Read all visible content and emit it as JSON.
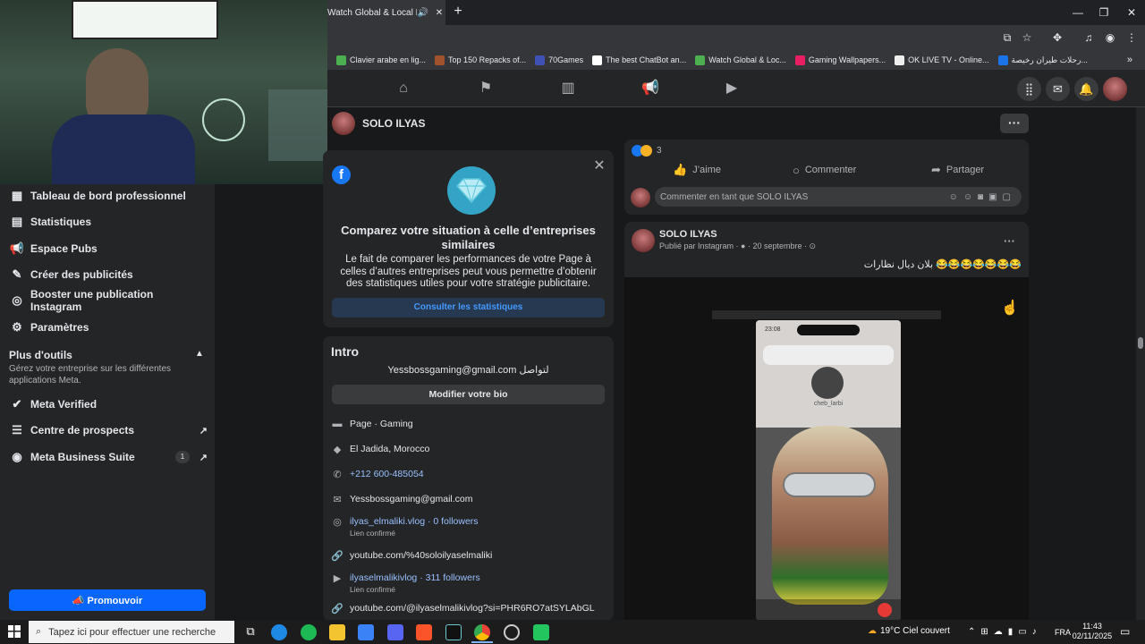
{
  "browser": {
    "tab_title": "Watch Global & Local Live",
    "tab_audio": "🔊",
    "tab_close": "✕",
    "new_tab": "+",
    "window": {
      "minimize": "—",
      "maximize": "❐",
      "close": "✕"
    },
    "bookmarks": [
      {
        "label": "Clavier arabe en lig...",
        "color": "#4caf50"
      },
      {
        "label": "Top 150 Repacks of...",
        "color": "#a0522d"
      },
      {
        "label": "70Games",
        "color": "#3f51b5"
      },
      {
        "label": "The best ChatBot an...",
        "color": "#ffffff"
      },
      {
        "label": "Watch Global & Loc...",
        "color": "#4caf50"
      },
      {
        "label": "Gaming Wallpapers...",
        "color": "#e91e63"
      },
      {
        "label": "OK LIVE TV - Online...",
        "color": "#eeeeee"
      },
      {
        "label": "رحلات طيران رخيصة...",
        "color": "#1a73e8"
      }
    ],
    "bookmarks_more": "»"
  },
  "fb_nav": {
    "icons": [
      "home-icon",
      "flag-icon",
      "chart-icon",
      "megaphone-icon",
      "video-icon"
    ],
    "right_icons": [
      "menu-grid-icon",
      "messenger-icon",
      "bell-icon"
    ]
  },
  "page": {
    "name": "SOLO ILYAS",
    "more": "···"
  },
  "left_menu": {
    "items": [
      {
        "label": "Tableau de bord professionnel",
        "icon": "dashboard-icon"
      },
      {
        "label": "Statistiques",
        "icon": "stats-icon"
      },
      {
        "label": "Espace Pubs",
        "icon": "ads-icon"
      },
      {
        "label": "Créer des publicités",
        "icon": "edit-icon"
      },
      {
        "label": "Booster une publication Instagram",
        "icon": "instagram-icon"
      },
      {
        "label": "Paramètres",
        "icon": "gear-icon"
      }
    ],
    "plus_title": "Plus d'outils",
    "plus_desc": "Gérez votre entreprise sur les différentes applications Meta.",
    "tools": [
      {
        "label": "Meta Verified",
        "icon": "verified-icon"
      },
      {
        "label": "Centre de prospects",
        "icon": "prospects-icon"
      },
      {
        "label": "Meta Business Suite",
        "icon": "business-suite-icon"
      }
    ],
    "badge": "1",
    "promote": "📣 Promouvoir"
  },
  "compare_card": {
    "title": "Comparez votre situation à celle d’entreprises similaires",
    "text": "Le fait de comparer les performances de votre Page à celles d’autres entreprises peut vous permettre d’obtenir des statistiques utiles pour votre stratégie publicitaire.",
    "button": "Consulter les statistiques"
  },
  "intro": {
    "title": "Intro",
    "bio": "Yessbossgaming@gmail.com لتواصل",
    "edit_bio": "Modifier votre bio",
    "category": "Page · Gaming",
    "location": "El Jadida, Morocco",
    "phone": "+212 600-485054",
    "email": "Yessbossgaming@gmail.com",
    "instagram": "ilyas_elmaliki.vlog · 0 followers",
    "instagram_sub": "Lien confirmé",
    "youtube1": "youtube.com/%40soloilyaselmaliki",
    "youtube_channel": "ilyaselmalikivlog · 311 followers",
    "youtube_channel_sub": "Lien confirmé",
    "youtube2": "youtube.com/@ilyaselmalikivlog?si=PHR6RO7atSYLAbGL"
  },
  "post1": {
    "reaction_count": "3",
    "like": "J’aime",
    "comment": "Commenter",
    "share": "Partager",
    "comment_placeholder": "Commenter en tant que SOLO ILYAS"
  },
  "post2": {
    "author": "SOLO ILYAS",
    "meta": "Publié par Instagram · ● · 20 septembre · ⊙",
    "caption": "بلان ديال نظارات 😂😂😂😂😂😂😂",
    "more": "···",
    "phone_time": "23:08",
    "phone_name": "cheb_larbi"
  },
  "taskbar": {
    "search_placeholder": "Tapez ici pour effectuer une recherche",
    "weather": "19°C  Ciel couvert",
    "lang": "FRA",
    "time": "11:43",
    "date": "02/11/2025"
  }
}
